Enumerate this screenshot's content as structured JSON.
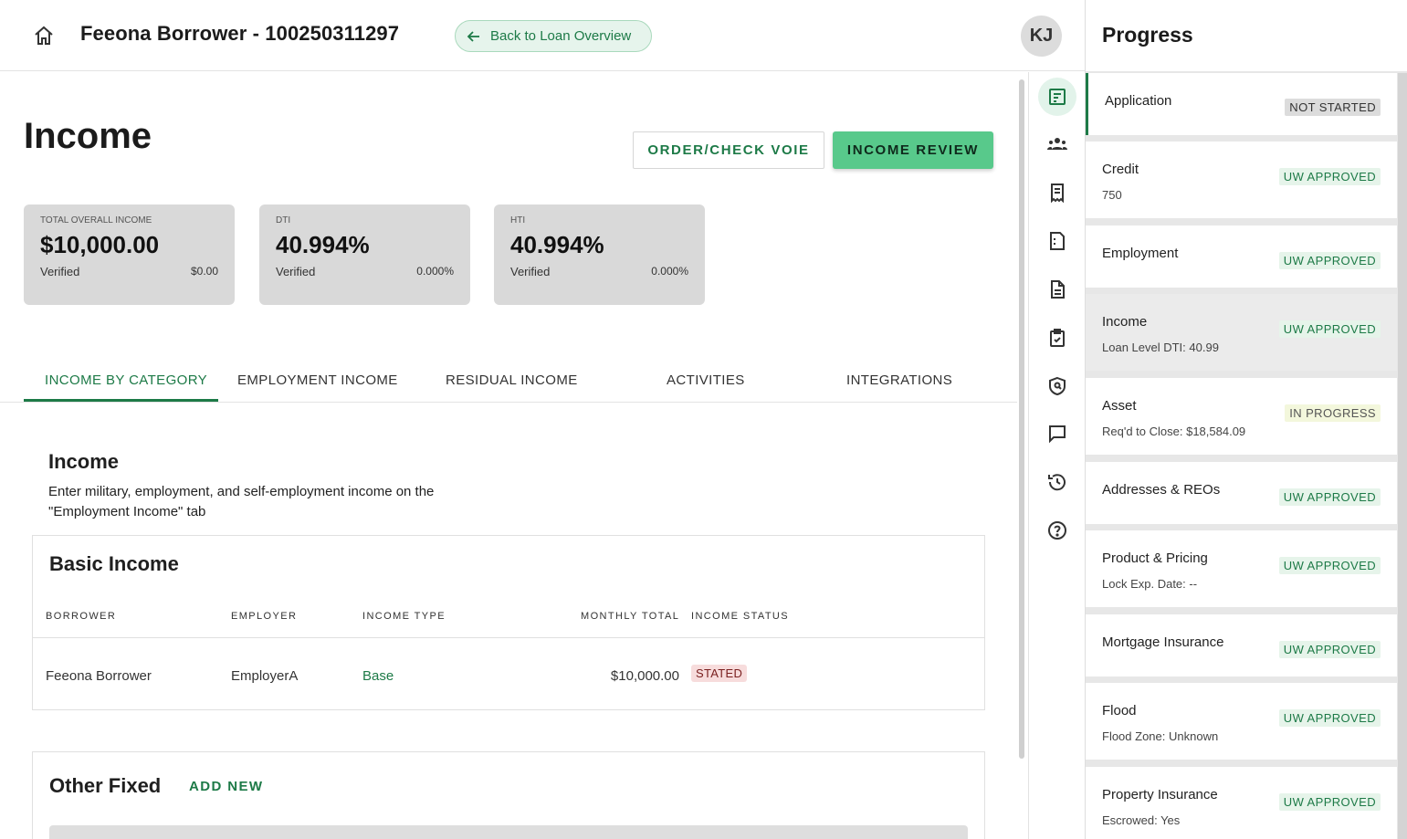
{
  "header": {
    "loan_title": "Feeona Borrower - 100250311297",
    "back_label": "Back to Loan Overview",
    "avatar_initials": "KJ"
  },
  "page": {
    "title": "Income",
    "order_voie_label": "ORDER/CHECK VOIE",
    "income_review_label": "INCOME REVIEW"
  },
  "cards": [
    {
      "label": "TOTAL OVERALL INCOME",
      "value": "$10,000.00",
      "foot_label": "Verified",
      "foot_value": "$0.00"
    },
    {
      "label": "DTI",
      "value": "40.994%",
      "foot_label": "Verified",
      "foot_value": "0.000%"
    },
    {
      "label": "HTI",
      "value": "40.994%",
      "foot_label": "Verified",
      "foot_value": "0.000%"
    }
  ],
  "tabs": [
    "INCOME BY CATEGORY",
    "EMPLOYMENT INCOME",
    "RESIDUAL INCOME",
    "ACTIVITIES",
    "INTEGRATIONS"
  ],
  "section": {
    "title": "Income",
    "description": "Enter military, employment, and self-employment income on the \"Employment Income\" tab"
  },
  "basic_income": {
    "title": "Basic Income",
    "columns": [
      "BORROWER",
      "EMPLOYER",
      "INCOME TYPE",
      "MONTHLY TOTAL",
      "INCOME STATUS"
    ],
    "rows": [
      {
        "borrower": "Feeona Borrower",
        "employer": "EmployerA",
        "income_type": "Base",
        "monthly_total": "$10,000.00",
        "status": "STATED"
      }
    ]
  },
  "other_fixed": {
    "title": "Other Fixed",
    "add_label": "ADD NEW"
  },
  "rail_icons": [
    "checklist-icon",
    "people-icon",
    "receipt-icon",
    "document-corner-icon",
    "document-lines-icon",
    "clipboard-check-icon",
    "shield-search-icon",
    "chat-icon",
    "history-icon",
    "help-icon"
  ],
  "progress": {
    "title": "Progress",
    "items": [
      {
        "name": "Application",
        "sub": "",
        "status": "NOT STARTED",
        "kind": "notstarted"
      },
      {
        "name": "Credit",
        "sub": "750",
        "status": "UW APPROVED",
        "kind": "approved"
      },
      {
        "name": "Employment",
        "sub": "",
        "status": "UW APPROVED",
        "kind": "approved"
      },
      {
        "name": "Income",
        "sub": "Loan Level DTI: 40.99",
        "status": "UW APPROVED",
        "kind": "approved"
      },
      {
        "name": "Asset",
        "sub": "Req'd to Close: $18,584.09",
        "status": "IN PROGRESS",
        "kind": "progress"
      },
      {
        "name": "Addresses & REOs",
        "sub": "",
        "status": "UW APPROVED",
        "kind": "approved"
      },
      {
        "name": "Product & Pricing",
        "sub": "Lock Exp. Date: --",
        "status": "UW APPROVED",
        "kind": "approved"
      },
      {
        "name": "Mortgage Insurance",
        "sub": "",
        "status": "UW APPROVED",
        "kind": "approved"
      },
      {
        "name": "Flood",
        "sub": "Flood Zone: Unknown",
        "status": "UW APPROVED",
        "kind": "approved"
      },
      {
        "name": "Property Insurance",
        "sub": "Escrowed: Yes",
        "status": "UW APPROVED",
        "kind": "approved"
      }
    ]
  },
  "colors": {
    "accent": "#1d7a47",
    "primary_button": "#58c98b",
    "card_bg": "#d9d9d9"
  }
}
